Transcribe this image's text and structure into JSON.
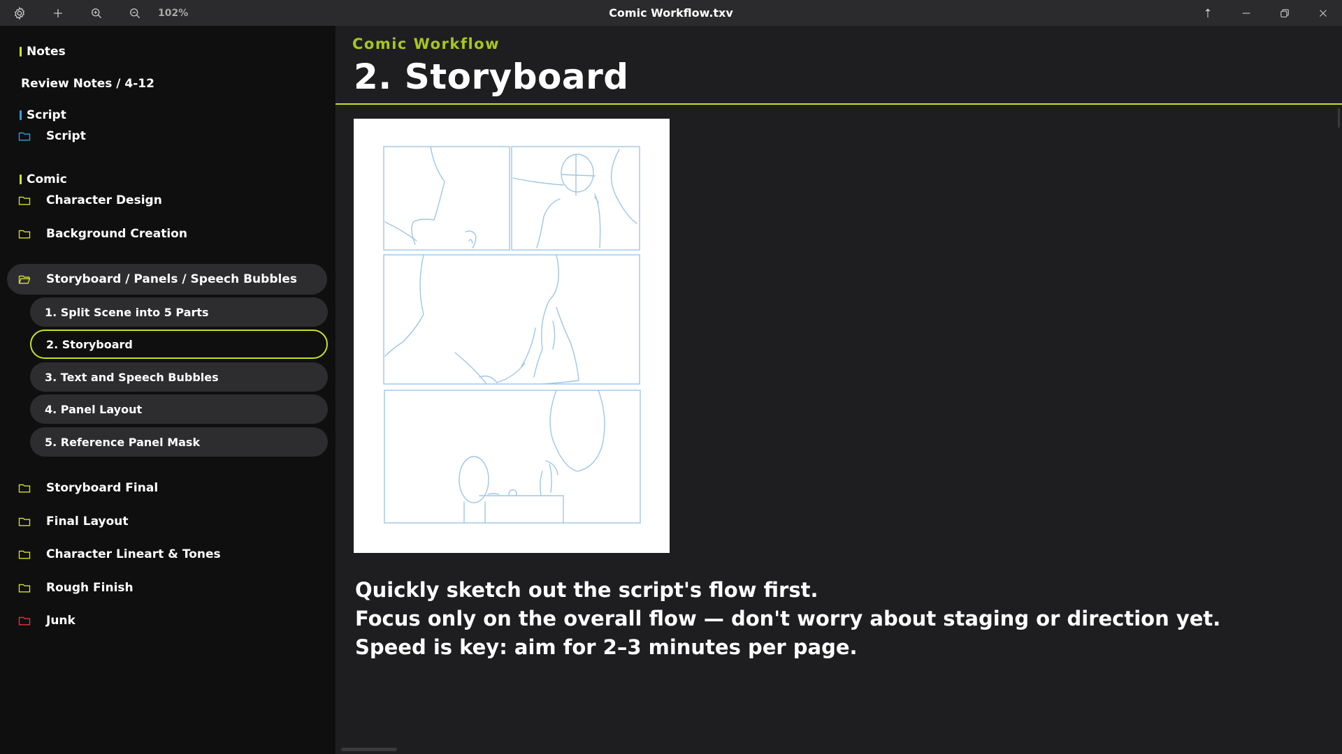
{
  "titlebar": {
    "title": "Comic Workflow.txv",
    "zoom": "102%",
    "buttons": [
      "settings-icon",
      "plus-icon",
      "zoom-in-icon",
      "zoom-out-icon"
    ],
    "window_buttons": [
      "pin-icon",
      "minimize-icon",
      "restore-icon",
      "close-icon"
    ]
  },
  "sidebar": {
    "sections": {
      "notes": "Notes",
      "script": "Script",
      "comic": "Comic"
    },
    "review_notes": "Review Notes / 4-12",
    "items": {
      "script": "Script",
      "character_design": "Character Design",
      "background_creation": "Background Creation",
      "storyboard_panels": "Storyboard / Panels / Speech Bubbles",
      "storyboard_final": "Storyboard Final",
      "final_layout": "Final Layout",
      "lineart_tones": "Character Lineart & Tones",
      "rough_finish": "Rough Finish",
      "junk": "Junk"
    },
    "subitems": [
      "1. Split Scene into 5 Parts",
      "2. Storyboard",
      "3. Text and Speech Bubbles",
      "4. Panel Layout",
      "5. Reference Panel Mask"
    ],
    "active_subitem": "2. Storyboard"
  },
  "main": {
    "breadcrumb": "Comic Workflow",
    "title": "2. Storyboard",
    "body_lines": [
      "Quickly sketch out the script's flow first.",
      "Focus only on the overall flow — don't worry about staging or direction yet.",
      "Speed is key: aim for 2–3 minutes per page."
    ]
  },
  "colors": {
    "accent": "#c9e020",
    "breadcrumb": "#a7c71c",
    "folder_yellow": "#d7e12a",
    "folder_blue": "#2fa3e0",
    "folder_red": "#e3363a",
    "sketch_lines": "#9ec6e8"
  }
}
